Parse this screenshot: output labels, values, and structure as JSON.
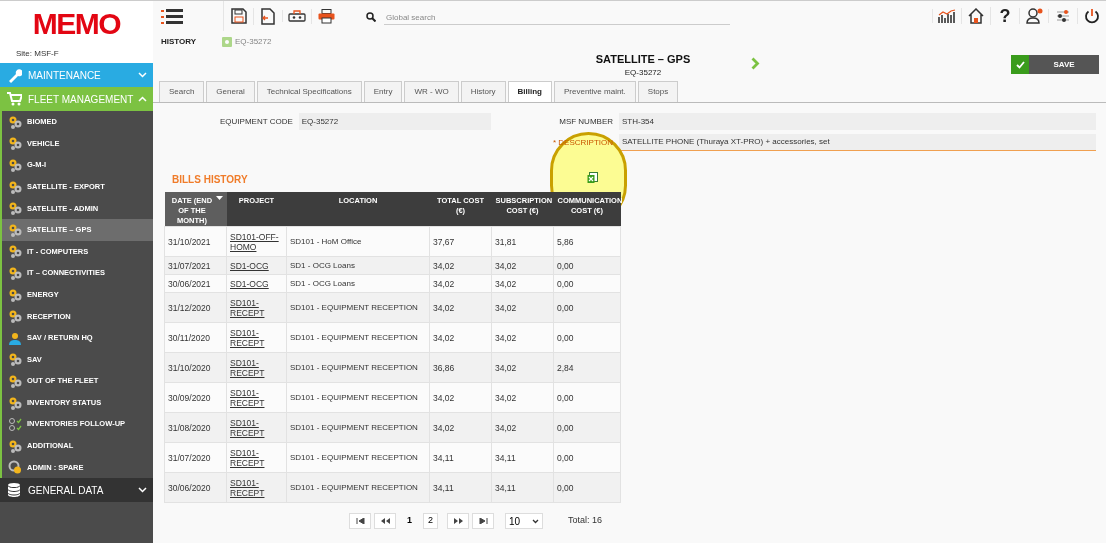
{
  "app": {
    "logo": "MEMO",
    "site": "Site: MSF-F"
  },
  "sidebar": {
    "sections": [
      {
        "label": "MAINTENANCE",
        "kind": "maintenance",
        "expanded": false
      },
      {
        "label": "FLEET MANAGEMENT",
        "kind": "fleet",
        "expanded": true,
        "items": [
          {
            "label": "BIOMED",
            "kind": "gears",
            "selected": false
          },
          {
            "label": "VEHICLE",
            "kind": "gears",
            "selected": false
          },
          {
            "label": "G-M-I",
            "kind": "gears",
            "selected": false
          },
          {
            "label": "SATELLITE - EXPORT",
            "kind": "gears",
            "selected": false
          },
          {
            "label": "SATELLITE - ADMIN",
            "kind": "gears",
            "selected": false
          },
          {
            "label": "SATELLITE – GPS",
            "kind": "gears",
            "selected": true
          },
          {
            "label": "IT - COMPUTERS",
            "kind": "gears",
            "selected": false
          },
          {
            "label": "IT – CONNECTIVITIES",
            "kind": "gears",
            "selected": false
          },
          {
            "label": "ENERGY",
            "kind": "gears",
            "selected": false
          },
          {
            "label": "RECEPTION",
            "kind": "gears",
            "selected": false
          },
          {
            "label": "SAV / RETURN HQ",
            "kind": "worker",
            "selected": false
          },
          {
            "label": "SAV",
            "kind": "gears",
            "selected": false
          },
          {
            "label": "OUT OF THE FLEET",
            "kind": "gears",
            "selected": false
          },
          {
            "label": "INVENTORY STATUS",
            "kind": "gears",
            "selected": false
          },
          {
            "label": "INVENTORIES FOLLOW-UP",
            "kind": "checklist",
            "selected": false
          },
          {
            "label": "ADDITIONAL",
            "kind": "gears",
            "selected": false
          },
          {
            "label": "ADMIN : SPARE",
            "kind": "spare",
            "selected": false
          }
        ]
      },
      {
        "label": "GENERAL DATA",
        "kind": "database",
        "expanded": false
      }
    ]
  },
  "toolbar": {
    "menu_label": "HISTORY",
    "breadcrumb": "EQ-35272",
    "search": {
      "placeholder": "Global search"
    },
    "help": "?"
  },
  "header": {
    "title": "SATELLITE – GPS",
    "subtitle": "EQ-35272",
    "save": "SAVE"
  },
  "tabs": [
    {
      "label": "Search",
      "selected": false
    },
    {
      "label": "General",
      "selected": false
    },
    {
      "label": "Technical Specifications",
      "selected": false
    },
    {
      "label": "Entry",
      "selected": false
    },
    {
      "label": "WR - WO",
      "selected": false
    },
    {
      "label": "History",
      "selected": false
    },
    {
      "label": "Billing",
      "selected": true
    },
    {
      "label": "Preventive maint.",
      "selected": false
    },
    {
      "label": "Stops",
      "selected": false
    }
  ],
  "fields": [
    {
      "label": "EQUIPMENT CODE",
      "value": "EQ-35272",
      "required": false
    },
    {
      "label": "MSF NUMBER",
      "value": "STH-354",
      "required": false
    },
    {
      "label": "* DESCRIPTION",
      "value": "SATELLITE PHONE (Thuraya XT-PRO) + accessories, set",
      "required": true
    }
  ],
  "bills": {
    "title": "BILLS HISTORY",
    "columns": [
      {
        "label": "DATE (END OF THE MONTH)",
        "sorted": true
      },
      {
        "label": "PROJECT",
        "sorted": false
      },
      {
        "label": "LOCATION",
        "sorted": false
      },
      {
        "label": "TOTAL COST (€)",
        "sorted": false
      },
      {
        "label": "SUBSCRIPTION COST (€)",
        "sorted": false
      },
      {
        "label": "COMMUNICATION COST (€)",
        "sorted": false
      }
    ],
    "rows": [
      [
        "31/10/2021",
        "SD101-OFF-HOMO",
        "SD101 - HoM Office",
        "37,67",
        "31,81",
        "5,86"
      ],
      [
        "31/07/2021",
        "SD1-OCG",
        "SD1 - OCG Loans",
        "34,02",
        "34,02",
        "0,00"
      ],
      [
        "30/06/2021",
        "SD1-OCG",
        "SD1 - OCG Loans",
        "34,02",
        "34,02",
        "0,00"
      ],
      [
        "31/12/2020",
        "SD101-RECEPT",
        "SD101 - EQUIPMENT RECEPTION",
        "34,02",
        "34,02",
        "0,00"
      ],
      [
        "30/11/2020",
        "SD101-RECEPT",
        "SD101 - EQUIPMENT RECEPTION",
        "34,02",
        "34,02",
        "0,00"
      ],
      [
        "31/10/2020",
        "SD101-RECEPT",
        "SD101 - EQUIPMENT RECEPTION",
        "36,86",
        "34,02",
        "2,84"
      ],
      [
        "30/09/2020",
        "SD101-RECEPT",
        "SD101 - EQUIPMENT RECEPTION",
        "34,02",
        "34,02",
        "0,00"
      ],
      [
        "31/08/2020",
        "SD101-RECEPT",
        "SD101 - EQUIPMENT RECEPTION",
        "34,02",
        "34,02",
        "0,00"
      ],
      [
        "31/07/2020",
        "SD101-RECEPT",
        "SD101 - EQUIPMENT RECEPTION",
        "34,11",
        "34,11",
        "0,00"
      ],
      [
        "30/06/2020",
        "SD101-RECEPT",
        "SD101 - EQUIPMENT RECEPTION",
        "34,11",
        "34,11",
        "0,00"
      ]
    ],
    "pages": [
      {
        "label": "1",
        "selected": true
      },
      {
        "label": "2",
        "selected": false
      }
    ],
    "page_size": "10",
    "total": "Total: 16"
  }
}
